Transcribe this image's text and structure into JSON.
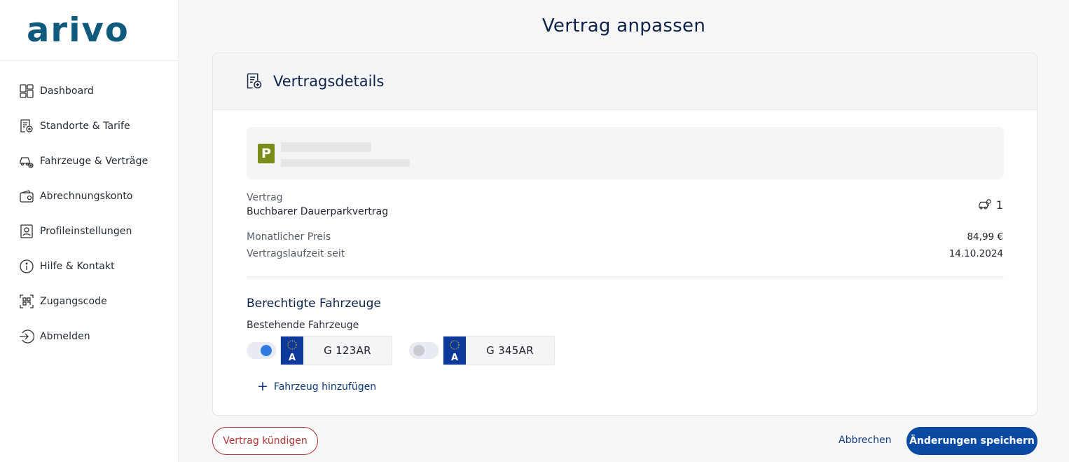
{
  "brand": {
    "name": "arivo",
    "color": "#0f5a7d"
  },
  "sidebar": {
    "items": [
      {
        "label": "Dashboard",
        "icon": "dashboard-icon"
      },
      {
        "label": "Standorte & Tarife",
        "icon": "location-tariff-icon"
      },
      {
        "label": "Fahrzeuge & Verträge",
        "icon": "vehicle-settings-icon"
      },
      {
        "label": "Abrechnungskonto",
        "icon": "wallet-icon"
      },
      {
        "label": "Profileinstellungen",
        "icon": "profile-icon"
      },
      {
        "label": "Hilfe & Kontakt",
        "icon": "info-icon"
      },
      {
        "label": "Zugangscode",
        "icon": "qr-code-icon"
      },
      {
        "label": "Abmelden",
        "icon": "logout-icon"
      }
    ]
  },
  "page": {
    "title": "Vertrag anpassen"
  },
  "card": {
    "title": "Vertragsdetails",
    "location": {
      "badge": "P"
    },
    "contract_label": "Vertrag",
    "contract_value": "Buchbarer Dauerparkvertrag",
    "vehicle_count": "1",
    "price_label": "Monatlicher Preis",
    "price_value": "84,99 €",
    "term_label": "Vertragslaufzeit seit",
    "term_value": "14.10.2024",
    "vehicles_title": "Berechtigte Fahrzeuge",
    "vehicles_subtitle": "Bestehende Fahrzeuge",
    "vehicles": [
      {
        "country": "A",
        "plate": "G 123AR",
        "enabled": true
      },
      {
        "country": "A",
        "plate": "G 345AR",
        "enabled": false
      }
    ],
    "add_vehicle_label": "Fahrzeug hinzufügen"
  },
  "actions": {
    "cancel_contract": "Vertrag kündigen",
    "abort": "Abbrechen",
    "save": "Änderungen speichern"
  },
  "colors": {
    "primary": "#0b4aa2",
    "danger": "#b23434",
    "toggle_on": "#2f7ce0",
    "parking_badge": "#7c8c1c"
  }
}
